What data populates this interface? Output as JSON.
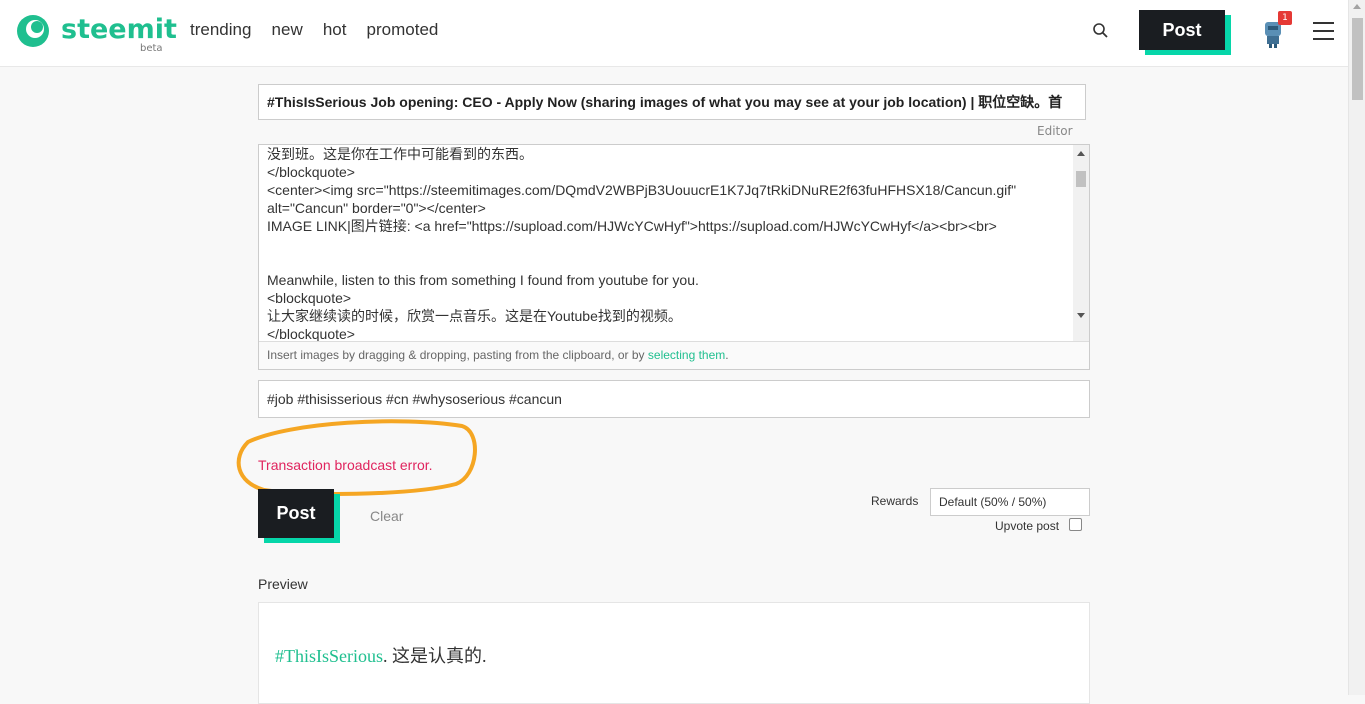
{
  "header": {
    "logo_text": "steemit",
    "logo_beta": "beta",
    "nav": [
      "trending",
      "new",
      "hot",
      "promoted"
    ],
    "post_label": "Post",
    "notification_count": "1",
    "brand_color": "#1fbf8f",
    "accent_color": "#06d6a9"
  },
  "editor": {
    "title_value": "#ThisIsSerious Job opening: CEO - Apply Now (sharing images of what you may see at your job location) | 职位空缺。首",
    "editor_link": "Editor",
    "body_lines": [
      "没到班。这是你在工作中可能看到的东西。",
      "</blockquote>",
      "<center><img src=\"https://steemitimages.com/DQmdV2WBPjB3UouucrE1K7Jq7tRkiDNuRE2f63fuHFHSX18/Cancun.gif\"",
      "alt=\"Cancun\" border=\"0\"></center>",
      "IMAGE LINK|图片链接: <a href=\"https://supload.com/HJWcYCwHyf\">https://supload.com/HJWcYCwHyf</a><br><br>",
      "",
      "",
      "Meanwhile, listen to this from something I found from youtube for you.",
      "<blockquote>",
      "让大家继续读的时候，欣赏一点音乐。这是在Youtube找到的视频。",
      "</blockquote>"
    ],
    "hint_text": "Insert images by dragging & dropping, pasting from the clipboard, or by ",
    "hint_link": "selecting them",
    "hint_end": ".",
    "tags_value": "#job #thisisserious #cn #whysoserious #cancun",
    "error_message": "Transaction broadcast error.",
    "post_label": "Post",
    "clear_label": "Clear",
    "rewards_label": "Rewards",
    "rewards_value": "Default (50% / 50%)",
    "upvote_label": "Upvote post"
  },
  "preview": {
    "label": "Preview",
    "tag_text": "#ThisIsSerious",
    "rest_text": ". 这是认真的."
  }
}
